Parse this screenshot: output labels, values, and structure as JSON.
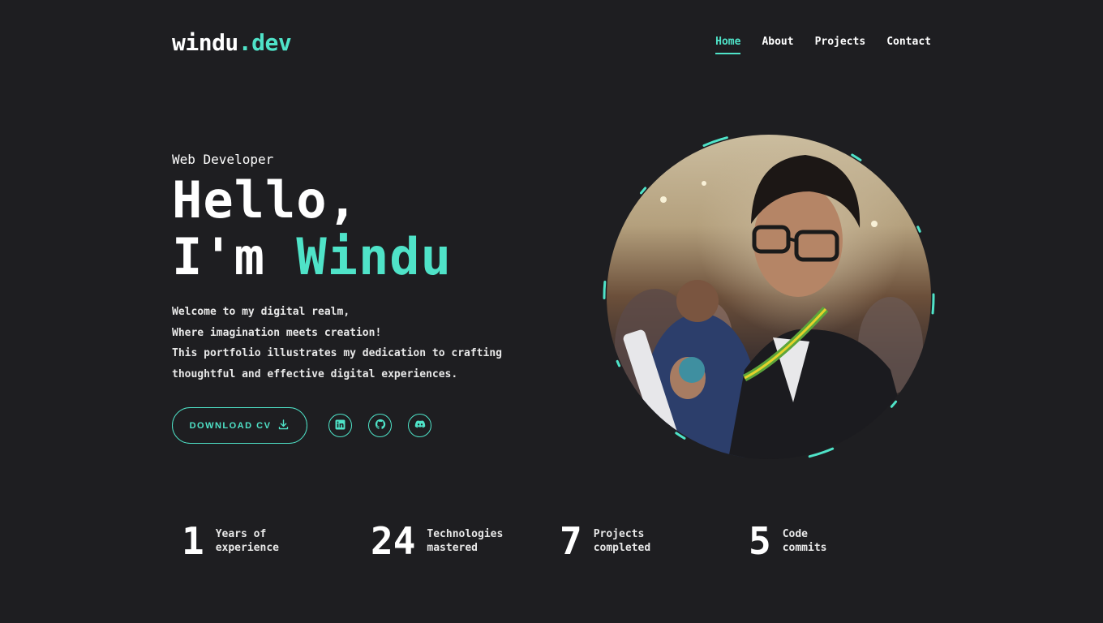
{
  "brand": {
    "name": "windu",
    "suffix": ".dev"
  },
  "nav": {
    "home": "Home",
    "about": "About",
    "projects": "Projects",
    "contact": "Contact"
  },
  "hero": {
    "role": "Web Developer",
    "greeting": "Hello,",
    "intro_prefix": "I'm ",
    "name": "Windu",
    "intro_lines": [
      "Welcome to my digital realm,",
      "Where imagination meets creation!",
      "This portfolio illustrates my dedication to crafting",
      "thoughtful and effective digital experiences."
    ],
    "cta_label": "DOWNLOAD CV",
    "cta_icon": "download-icon",
    "socials": [
      {
        "icon": "linkedin-icon"
      },
      {
        "icon": "github-icon"
      },
      {
        "icon": "discord-icon"
      }
    ]
  },
  "stats": [
    {
      "number": "1",
      "line1": "Years of",
      "line2": "experience"
    },
    {
      "number": "24",
      "line1": "Technologies",
      "line2": "mastered"
    },
    {
      "number": "7",
      "line1": "Projects",
      "line2": "completed"
    },
    {
      "number": "5",
      "line1": "Code",
      "line2": "commits"
    }
  ],
  "colors": {
    "background": "#1e1e21",
    "accent": "#4fe3c8",
    "text": "#ffffff"
  }
}
